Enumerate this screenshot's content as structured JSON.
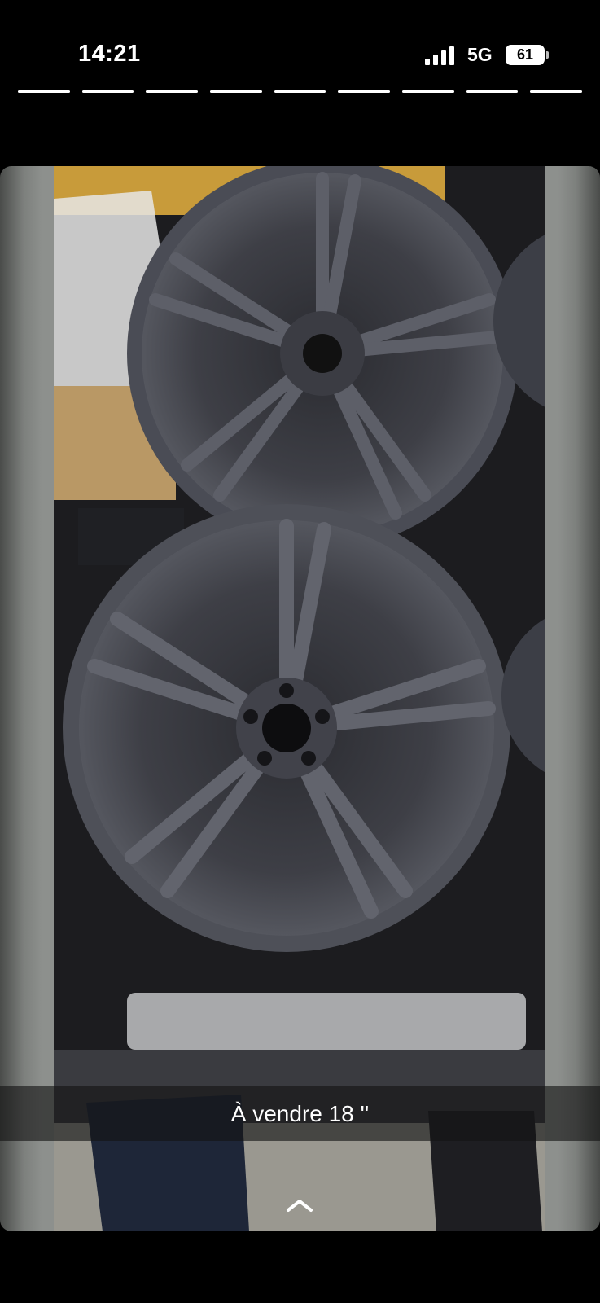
{
  "status_bar": {
    "time": "14:21",
    "network": "5G",
    "battery": "61",
    "battery_level": 0.61,
    "signal_bars": 4
  },
  "story": {
    "segments_total": 9,
    "segments_seen": 9,
    "caption": "À vendre 18 ''"
  },
  "colors": {
    "background": "#000000",
    "caption_overlay": "rgba(20,20,20,0.62)",
    "progress_active": "#ffffff"
  },
  "icons": {
    "signal": "cellular-signal-icon",
    "battery": "battery-icon",
    "swipe_up": "chevron-up-icon"
  }
}
